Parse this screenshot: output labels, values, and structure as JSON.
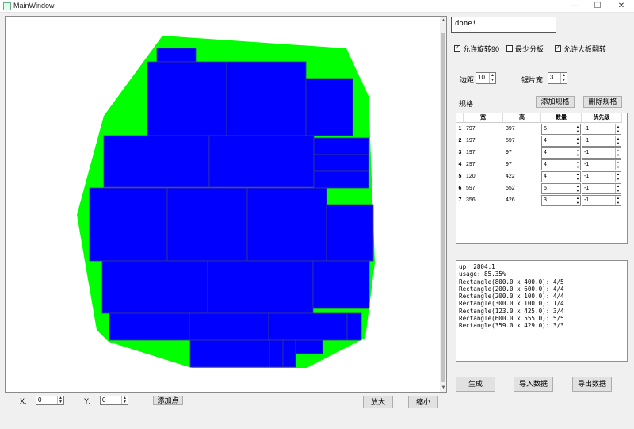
{
  "window": {
    "title": "MainWindow",
    "minimize_glyph": "—",
    "maximize_glyph": "☐",
    "close_glyph": "✕"
  },
  "status_text": "done!",
  "options": {
    "allow_rotate_label": "允许旋转90",
    "allow_rotate_checked": true,
    "min_boards_label": "最少分板",
    "min_boards_checked": false,
    "allow_flip_label": "允许大板翻转",
    "allow_flip_checked": true
  },
  "margin": {
    "label": "边距",
    "value": "10"
  },
  "saw_width": {
    "label": "锯片宽",
    "value": "3"
  },
  "specs": {
    "label": "规格",
    "add_button": "添加规格",
    "delete_button": "删除规格",
    "columns": [
      "宽",
      "高",
      "数量",
      "优先级"
    ],
    "rows": [
      {
        "index": "1",
        "w": "797",
        "h": "397",
        "qty": "5",
        "priority": "-1"
      },
      {
        "index": "2",
        "w": "197",
        "h": "597",
        "qty": "4",
        "priority": "-1"
      },
      {
        "index": "3",
        "w": "197",
        "h": "97",
        "qty": "4",
        "priority": "-1"
      },
      {
        "index": "4",
        "w": "297",
        "h": "97",
        "qty": "4",
        "priority": "-1"
      },
      {
        "index": "5",
        "w": "120",
        "h": "422",
        "qty": "4",
        "priority": "-1"
      },
      {
        "index": "6",
        "w": "597",
        "h": "552",
        "qty": "5",
        "priority": "-1"
      },
      {
        "index": "7",
        "w": "356",
        "h": "426",
        "qty": "3",
        "priority": "-1"
      }
    ]
  },
  "log_lines": [
    "up: 2804.1",
    "usage: 85.35%",
    "Rectangle(800.0 x 400.0): 4/5",
    "Rectangle(200.0 x 600.0): 4/4",
    "Rectangle(200.0 x 100.0): 4/4",
    "Rectangle(300.0 x 100.0): 1/4",
    "Rectangle(123.0 x 425.0): 3/4",
    "Rectangle(600.0 x 555.0): 5/5",
    "Rectangle(359.0 x 429.0): 3/3"
  ],
  "actions": {
    "generate": "生成",
    "import": "导入数据",
    "export": "导出数据"
  },
  "point_input": {
    "x_label": "X:",
    "x_value": "0",
    "y_label": "Y:",
    "y_value": "0",
    "add_point": "添加点"
  },
  "zoom": {
    "in": "放大",
    "out": "缩小"
  },
  "colors": {
    "region": "#00ff00",
    "piece": "#0000ff",
    "piece_border": "#3a3a8a"
  }
}
